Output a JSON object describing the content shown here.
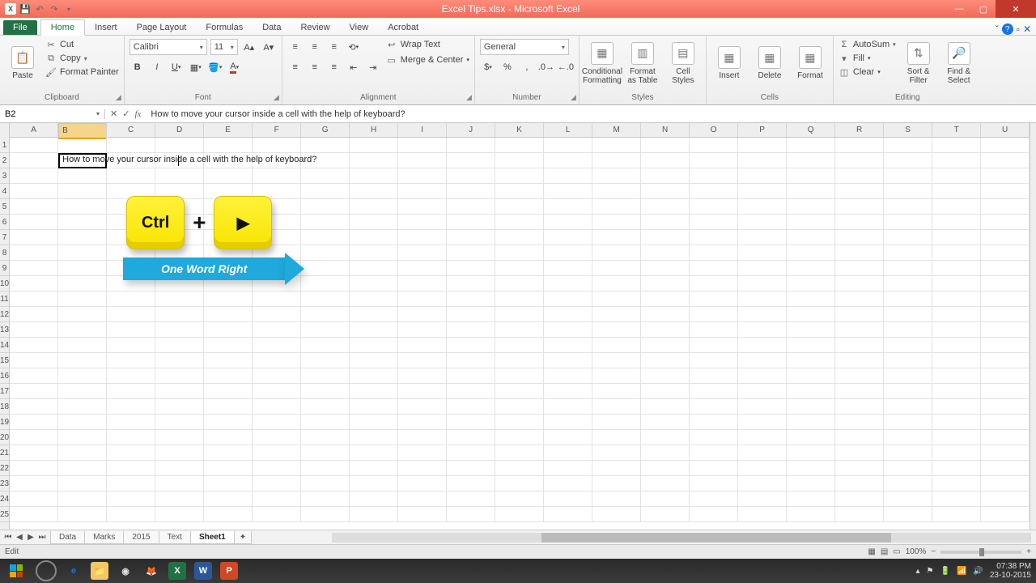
{
  "title": "Excel Tips.xlsx - Microsoft Excel",
  "tabs": {
    "file": "File",
    "home": "Home",
    "insert": "Insert",
    "pagelayout": "Page Layout",
    "formulas": "Formulas",
    "data": "Data",
    "review": "Review",
    "view": "View",
    "acrobat": "Acrobat"
  },
  "clipboard": {
    "label": "Clipboard",
    "paste": "Paste",
    "cut": "Cut",
    "copy": "Copy",
    "fmtpainter": "Format Painter"
  },
  "font": {
    "label": "Font",
    "family": "Calibri",
    "size": "11"
  },
  "alignment": {
    "label": "Alignment",
    "wrap": "Wrap Text",
    "merge": "Merge & Center"
  },
  "number": {
    "label": "Number",
    "format": "General"
  },
  "styles": {
    "label": "Styles",
    "cond": "Conditional Formatting",
    "fat": "Format as Table",
    "cell": "Cell Styles"
  },
  "cells": {
    "label": "Cells",
    "insert": "Insert",
    "delete": "Delete",
    "format": "Format"
  },
  "editing": {
    "label": "Editing",
    "autosum": "AutoSum",
    "fill": "Fill",
    "clear": "Clear",
    "sort": "Sort & Filter",
    "find": "Find & Select"
  },
  "namebox": "B2",
  "formula": "How to move your cursor inside a cell with the help of keyboard?",
  "cell_b2": "How to move your cursor inside a cell with the help of keyboard?",
  "columns": [
    "A",
    "B",
    "C",
    "D",
    "E",
    "F",
    "G",
    "H",
    "I",
    "J",
    "K",
    "L",
    "M",
    "N",
    "O",
    "P",
    "Q",
    "R",
    "S",
    "T",
    "U"
  ],
  "overlay": {
    "ctrl": "Ctrl",
    "plus": "+",
    "banner": "One Word Right",
    "triangle": "▶"
  },
  "sheets": {
    "data": "Data",
    "marks": "Marks",
    "y2015": "2015",
    "text": "Text",
    "sheet1": "Sheet1"
  },
  "status": {
    "mode": "Edit",
    "zoom": "100%"
  },
  "taskbar": {
    "time": "07:38 PM",
    "date": "23-10-2015"
  }
}
